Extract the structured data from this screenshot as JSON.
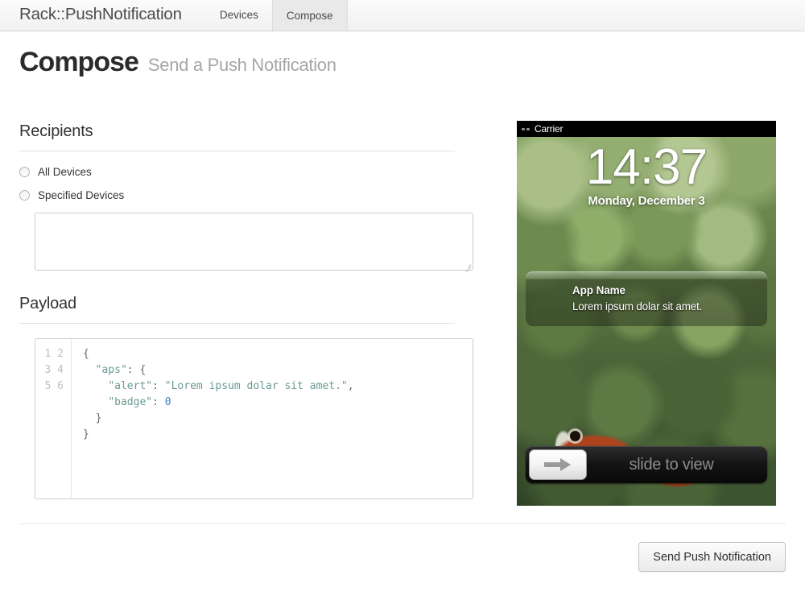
{
  "nav": {
    "brand": "Rack::PushNotification",
    "tabs": [
      {
        "label": "Devices",
        "active": false
      },
      {
        "label": "Compose",
        "active": true
      }
    ]
  },
  "header": {
    "title": "Compose",
    "subtitle": "Send a Push Notification"
  },
  "recipients": {
    "section_title": "Recipients",
    "options": [
      {
        "label": "All Devices",
        "checked": false
      },
      {
        "label": "Specified Devices",
        "checked": false
      }
    ],
    "devices_input_value": "",
    "devices_input_placeholder": ""
  },
  "payload": {
    "section_title": "Payload",
    "line_numbers": [
      "1",
      "2",
      "3",
      "4",
      "5",
      "6"
    ],
    "code_lines": [
      "{",
      "  \"aps\": {",
      "    \"alert\": \"Lorem ipsum dolar sit amet.\",",
      "    \"badge\": 0",
      "  }",
      "}"
    ],
    "json": {
      "aps": {
        "alert": "Lorem ipsum dolar sit amet.",
        "badge": 0
      }
    }
  },
  "preview": {
    "statusbar": {
      "carrier": "Carrier"
    },
    "lockscreen": {
      "time": "14:37",
      "date": "Monday, December 3"
    },
    "banner": {
      "app_name": "App Name",
      "message": "Lorem ipsum dolar sit amet."
    },
    "slider": {
      "label": "slide to view"
    }
  },
  "footer": {
    "send_label": "Send Push Notification"
  },
  "colors": {
    "accent_string": "#6a9a94",
    "accent_number": "#3b7fc4",
    "title": "#2b2b2b",
    "subtitle": "#a6a6a6",
    "nav_active_bg": "#e9e9e9"
  }
}
